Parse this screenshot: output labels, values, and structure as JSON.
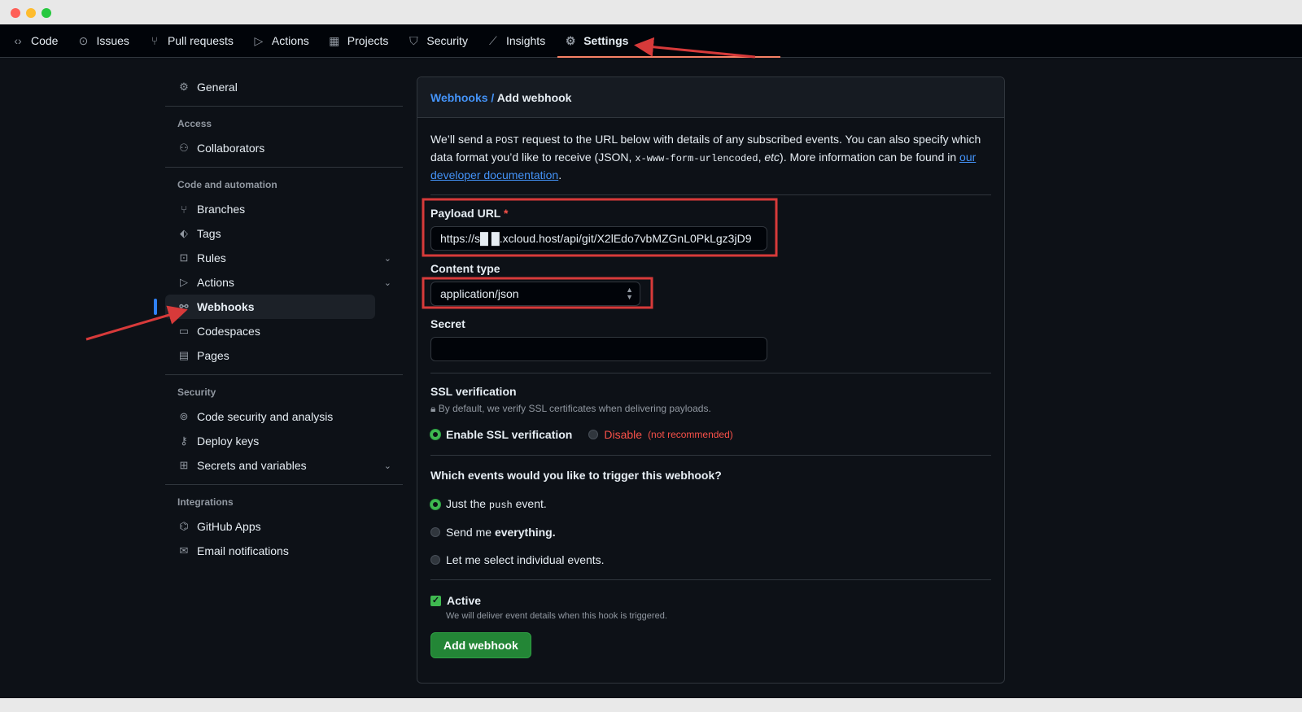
{
  "nav": {
    "tabs": [
      {
        "label": "Code",
        "icon": "code-icon"
      },
      {
        "label": "Issues",
        "icon": "issue-icon"
      },
      {
        "label": "Pull requests",
        "icon": "pull-request-icon"
      },
      {
        "label": "Actions",
        "icon": "play-icon"
      },
      {
        "label": "Projects",
        "icon": "table-icon"
      },
      {
        "label": "Security",
        "icon": "shield-icon"
      },
      {
        "label": "Insights",
        "icon": "graph-icon"
      },
      {
        "label": "Settings",
        "icon": "gear-icon",
        "selected": true
      }
    ]
  },
  "sidebar": {
    "general": "General",
    "access": {
      "title": "Access",
      "items": [
        "Collaborators"
      ]
    },
    "code": {
      "title": "Code and automation",
      "items": [
        "Branches",
        "Tags",
        "Rules",
        "Actions",
        "Webhooks",
        "Codespaces",
        "Pages"
      ]
    },
    "security": {
      "title": "Security",
      "items": [
        "Code security and analysis",
        "Deploy keys",
        "Secrets and variables"
      ]
    },
    "integrations": {
      "title": "Integrations",
      "items": [
        "GitHub Apps",
        "Email notifications"
      ]
    }
  },
  "main": {
    "breadcrumb_link": "Webhooks",
    "breadcrumb_sep": " / ",
    "breadcrumb_current": "Add webhook",
    "intro": {
      "t1": "We’ll send a ",
      "c1": "POST",
      "t2": " request to the URL below with details of any subscribed events. You can also specify which data format you’d like to receive (JSON, ",
      "c2": "x-www-form-urlencoded",
      "t3": ", ",
      "em": "etc",
      "t4": "). More information can be found in ",
      "link": "our developer documentation",
      "t5": "."
    },
    "payload_label": "Payload URL",
    "required": "*",
    "payload_value": "https://s█ █.xcloud.host/api/git/X2lEdo7vbMZGnL0PkLgz3jD9",
    "content_label": "Content type",
    "content_value": "application/json",
    "secret_label": "Secret",
    "secret_value": "",
    "ssl_title": "SSL verification",
    "ssl_note": "By default, we verify SSL certificates when delivering payloads.",
    "ssl_enable": "Enable SSL verification",
    "ssl_disable": "Disable",
    "ssl_disable_note": "(not recommended)",
    "events_title": "Which events would you like to trigger this webhook?",
    "ev1a": "Just the ",
    "ev1c": "push",
    "ev1b": " event.",
    "ev2a": "Send me ",
    "ev2b": "everything.",
    "ev3": "Let me select individual events.",
    "active_label": "Active",
    "active_checked": true,
    "active_note": "We will deliver event details when this hook is triggered.",
    "submit": "Add webhook"
  },
  "colors": {
    "annotation": "#d73a3a",
    "accent": "#2f81f7",
    "primary_button": "#238636"
  }
}
